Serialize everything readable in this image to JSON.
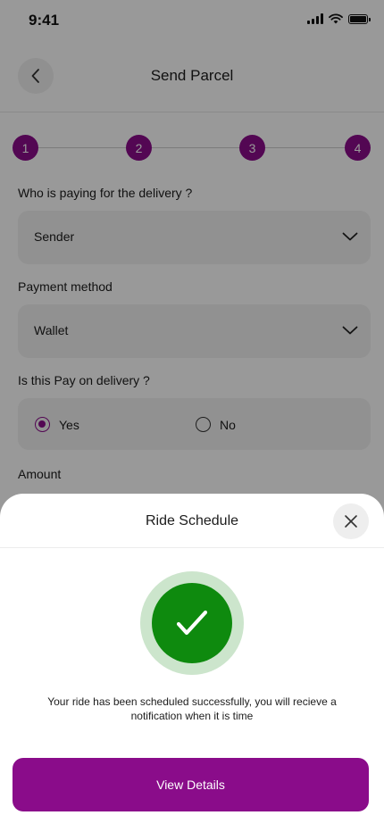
{
  "status_bar": {
    "time": "9:41"
  },
  "header": {
    "title": "Send Parcel"
  },
  "stepper": {
    "steps": [
      "1",
      "2",
      "3",
      "4"
    ]
  },
  "form": {
    "payer_label": "Who is paying for the delivery ?",
    "payer_value": "Sender",
    "payment_label": "Payment method",
    "payment_value": "Wallet",
    "pod_label": "Is this Pay on delivery ?",
    "pod_options": [
      {
        "label": "Yes",
        "selected": true
      },
      {
        "label": "No",
        "selected": false
      }
    ],
    "amount_label": "Amount"
  },
  "sheet": {
    "title": "Ride Schedule",
    "message": "Your ride has been scheduled successfully, you will recieve a notification when it is time",
    "button_label": "View Details"
  },
  "colors": {
    "primary": "#8a0c8a",
    "success": "#0e8a0e",
    "success_ring": "#cce5cc"
  },
  "icons": {
    "back": "chevron-left-icon",
    "dropdown": "chevron-down-icon",
    "close": "close-icon",
    "success": "checkmark-icon"
  }
}
